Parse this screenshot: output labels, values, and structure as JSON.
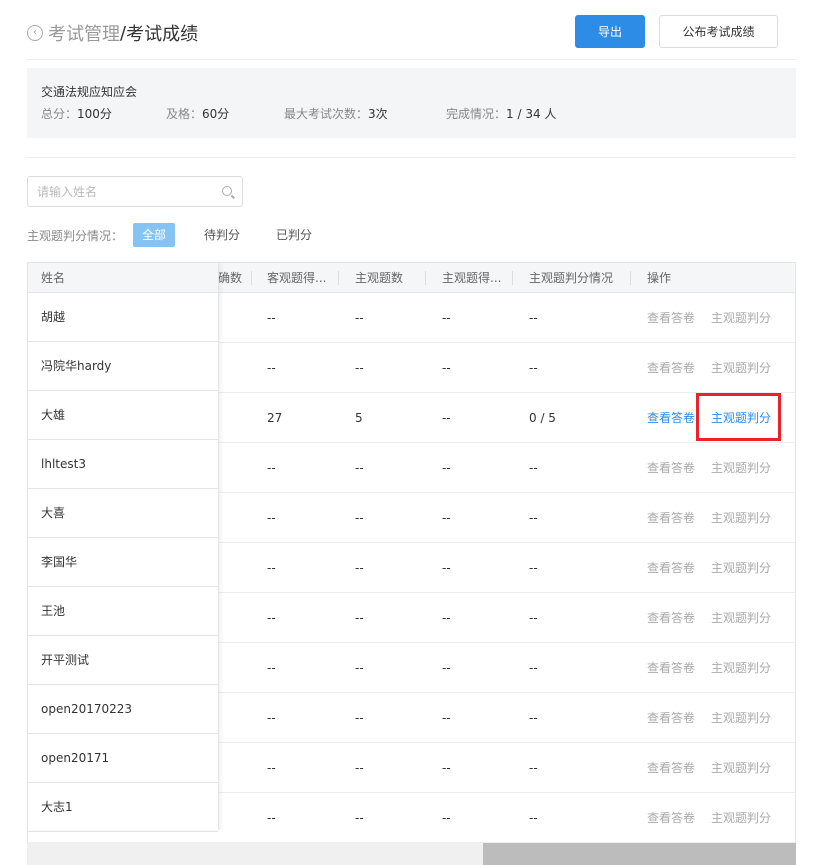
{
  "header": {
    "crumb_parent": "考试管理",
    "crumb_sep": "/",
    "crumb_current": "考试成绩",
    "export_label": "导出",
    "publish_label": "公布考试成绩"
  },
  "info": {
    "title": "交通法规应知应会",
    "total_label": "总分：",
    "total_value": "100分",
    "pass_label": "及格：",
    "pass_value": "60分",
    "max_attempts_label": "最大考试次数：",
    "max_attempts_value": "3次",
    "completion_label": "完成情况：",
    "completion_value": "1 / 34 人"
  },
  "search": {
    "placeholder": "请输入姓名"
  },
  "filter": {
    "label": "主观题判分情况：",
    "options": [
      "全部",
      "待判分",
      "已判分"
    ],
    "active": "全部"
  },
  "table": {
    "columns": [
      "姓名",
      "确数",
      "客观题得...",
      "主观题数",
      "主观题得...",
      "主观题判分情况",
      "操作"
    ],
    "action_view": "查看答卷",
    "action_grade": "主观题判分",
    "rows": [
      {
        "name": "胡越",
        "obj_score": "--",
        "subj_count": "--",
        "subj_score": "--",
        "grading": "--",
        "active": false
      },
      {
        "name": "冯院华hardy",
        "obj_score": "--",
        "subj_count": "--",
        "subj_score": "--",
        "grading": "--",
        "active": false
      },
      {
        "name": "大雄",
        "obj_score": "27",
        "subj_count": "5",
        "subj_score": "--",
        "grading": "0 / 5",
        "active": true
      },
      {
        "name": "lhltest3",
        "obj_score": "--",
        "subj_count": "--",
        "subj_score": "--",
        "grading": "--",
        "active": false
      },
      {
        "name": "大喜",
        "obj_score": "--",
        "subj_count": "--",
        "subj_score": "--",
        "grading": "--",
        "active": false
      },
      {
        "name": "李国华",
        "obj_score": "--",
        "subj_count": "--",
        "subj_score": "--",
        "grading": "--",
        "active": false
      },
      {
        "name": "王池",
        "obj_score": "--",
        "subj_count": "--",
        "subj_score": "--",
        "grading": "--",
        "active": false
      },
      {
        "name": "开平测试",
        "obj_score": "--",
        "subj_count": "--",
        "subj_score": "--",
        "grading": "--",
        "active": false
      },
      {
        "name": "open20170223",
        "obj_score": "--",
        "subj_count": "--",
        "subj_score": "--",
        "grading": "--",
        "active": false
      },
      {
        "name": "open20171",
        "obj_score": "--",
        "subj_count": "--",
        "subj_score": "--",
        "grading": "--",
        "active": false
      },
      {
        "name": "大志1",
        "obj_score": "--",
        "subj_count": "--",
        "subj_score": "--",
        "grading": "--",
        "active": false
      }
    ]
  },
  "colors": {
    "primary": "#2d8ce6",
    "highlight": "#e8242a",
    "filter_active": "#85c3f3"
  }
}
